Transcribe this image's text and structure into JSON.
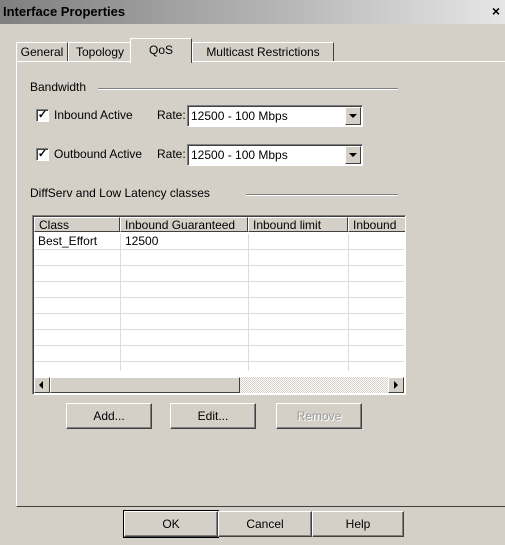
{
  "window": {
    "title": "Interface Properties",
    "close_glyph": "×"
  },
  "tabs": [
    {
      "label": "General"
    },
    {
      "label": "Topology"
    },
    {
      "label": "QoS"
    },
    {
      "label": "Multicast Restrictions"
    }
  ],
  "bandwidth": {
    "group_label": "Bandwidth",
    "inbound": {
      "label": "Inbound Active",
      "checked": true,
      "rate_label": "Rate:",
      "rate_value": "12500 - 100 Mbps"
    },
    "outbound": {
      "label": "Outbound Active",
      "checked": true,
      "rate_label": "Rate:",
      "rate_value": "12500 - 100 Mbps"
    },
    "check_glyph": "✓"
  },
  "diffserv": {
    "group_label": "DiffServ and Low Latency classes",
    "columns": [
      "Class",
      "Inbound Guaranteed",
      "Inbound limit",
      "Inbound"
    ],
    "rows": [
      [
        "Best_Effort",
        "12500",
        "",
        ""
      ]
    ]
  },
  "actions": {
    "add": "Add...",
    "edit": "Edit...",
    "remove": "Remove"
  },
  "footer": {
    "ok": "OK",
    "cancel": "Cancel",
    "help": "Help"
  }
}
